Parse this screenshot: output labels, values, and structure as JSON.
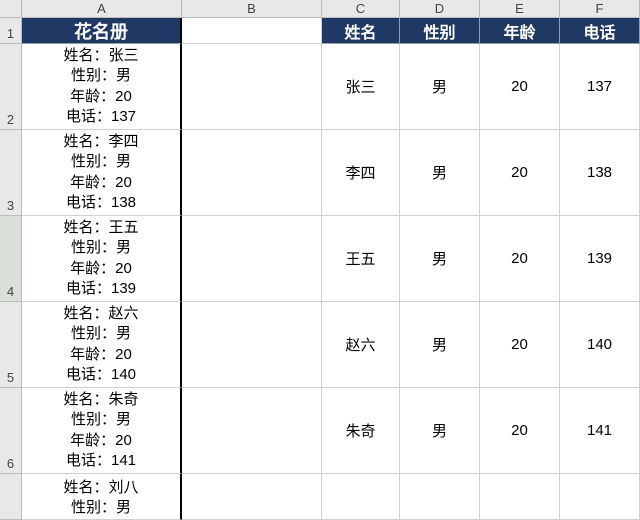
{
  "columns": [
    "A",
    "B",
    "C",
    "D",
    "E",
    "F"
  ],
  "row_numbers": [
    "1",
    "2",
    "3",
    "4",
    "5",
    "6"
  ],
  "roster_header": "花名册",
  "table_headers": {
    "name": "姓名",
    "gender": "性别",
    "age": "年龄",
    "phone": "电话"
  },
  "field_labels": {
    "name": "姓名：",
    "gender": "性别：",
    "age": "年龄：",
    "phone": "电话："
  },
  "people": [
    {
      "name": "张三",
      "gender": "男",
      "age": "20",
      "phone": "137"
    },
    {
      "name": "李四",
      "gender": "男",
      "age": "20",
      "phone": "138"
    },
    {
      "name": "王五",
      "gender": "男",
      "age": "20",
      "phone": "139"
    },
    {
      "name": "赵六",
      "gender": "男",
      "age": "20",
      "phone": "140"
    },
    {
      "name": "朱奇",
      "gender": "男",
      "age": "20",
      "phone": "141"
    },
    {
      "name": "刘八",
      "gender": "男"
    }
  ],
  "selected_row_header_index": 3
}
